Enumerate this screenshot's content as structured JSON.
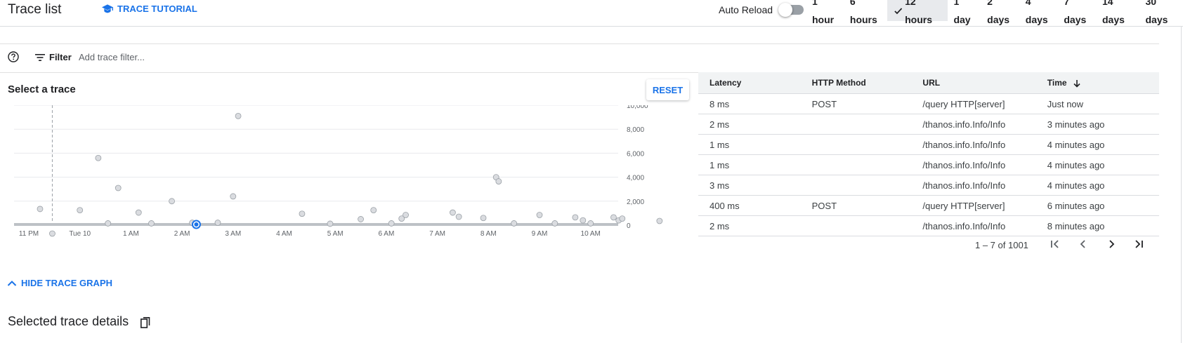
{
  "header": {
    "title": "Trace list",
    "tutorial_label": "TRACE TUTORIAL",
    "auto_reload_label": "Auto Reload",
    "auto_reload_on": false,
    "time_ranges": [
      {
        "label": "1 hour",
        "active": false
      },
      {
        "label": "6 hours",
        "active": false
      },
      {
        "label": "12 hours",
        "active": true
      },
      {
        "label": "1 day",
        "active": false
      },
      {
        "label": "2 days",
        "active": false
      },
      {
        "label": "4 days",
        "active": false
      },
      {
        "label": "7 days",
        "active": false
      },
      {
        "label": "14 days",
        "active": false
      },
      {
        "label": "30 days",
        "active": false
      }
    ]
  },
  "filter": {
    "label": "Filter",
    "placeholder": "Add trace filter..."
  },
  "chart": {
    "title": "Select a trace",
    "reset_label": "RESET"
  },
  "chart_data": {
    "type": "scatter",
    "x_ticks": [
      "11 PM",
      "Tue 10",
      "1 AM",
      "2 AM",
      "3 AM",
      "4 AM",
      "5 AM",
      "6 AM",
      "7 AM",
      "8 AM",
      "9 AM",
      "10 AM"
    ],
    "y_ticks": [
      "10,000",
      "8,000",
      "6,000",
      "4,000",
      "2,000",
      "0"
    ],
    "ylim": [
      0,
      10000
    ],
    "xlim": [
      0,
      12
    ],
    "ylabel": "",
    "xlabel": "",
    "grid": true,
    "y_axis_side": "right",
    "selected_x": 0.46,
    "points": [
      {
        "x": 0.22,
        "y": 1350
      },
      {
        "x": 0.46,
        "y": -700
      },
      {
        "x": 1.0,
        "y": 1250
      },
      {
        "x": 1.36,
        "y": 5600
      },
      {
        "x": 1.75,
        "y": 3100
      },
      {
        "x": 2.15,
        "y": 1050
      },
      {
        "x": 2.8,
        "y": 2000
      },
      {
        "x": 3.2,
        "y": 200
      },
      {
        "x": 3.3,
        "y": 0
      },
      {
        "x": 4.0,
        "y": 2400
      },
      {
        "x": 4.1,
        "y": 9100
      },
      {
        "x": 5.35,
        "y": 950
      },
      {
        "x": 6.5,
        "y": 500
      },
      {
        "x": 6.75,
        "y": 1250
      },
      {
        "x": 7.3,
        "y": 550
      },
      {
        "x": 7.38,
        "y": 850
      },
      {
        "x": 8.3,
        "y": 1050
      },
      {
        "x": 8.42,
        "y": 700
      },
      {
        "x": 8.9,
        "y": 600
      },
      {
        "x": 9.15,
        "y": 4000
      },
      {
        "x": 9.2,
        "y": 3650
      },
      {
        "x": 10.0,
        "y": 850
      },
      {
        "x": 10.7,
        "y": 650
      },
      {
        "x": 10.85,
        "y": 400
      },
      {
        "x": 11.45,
        "y": 650
      },
      {
        "x": 11.55,
        "y": 400
      },
      {
        "x": 11.62,
        "y": 550
      },
      {
        "x": 12.35,
        "y": 350
      },
      {
        "x": 1.55,
        "y": 150
      },
      {
        "x": 2.4,
        "y": 150
      },
      {
        "x": 3.7,
        "y": 200
      },
      {
        "x": 5.9,
        "y": 120
      },
      {
        "x": 7.1,
        "y": 150
      },
      {
        "x": 9.5,
        "y": 150
      },
      {
        "x": 10.3,
        "y": 150
      },
      {
        "x": 11.0,
        "y": 150
      }
    ]
  },
  "table": {
    "columns": [
      "Latency",
      "HTTP Method",
      "URL",
      "Time"
    ],
    "sort_column": "Time",
    "rows": [
      [
        "8 ms",
        "POST",
        "/query HTTP[server]",
        "Just now"
      ],
      [
        "2 ms",
        "",
        "/thanos.info.Info/Info",
        "3 minutes ago"
      ],
      [
        "1 ms",
        "",
        "/thanos.info.Info/Info",
        "4 minutes ago"
      ],
      [
        "1 ms",
        "",
        "/thanos.info.Info/Info",
        "4 minutes ago"
      ],
      [
        "3 ms",
        "",
        "/thanos.info.Info/Info",
        "4 minutes ago"
      ],
      [
        "400 ms",
        "POST",
        "/query HTTP[server]",
        "6 minutes ago"
      ],
      [
        "2 ms",
        "",
        "/thanos.info.Info/Info",
        "8 minutes ago"
      ]
    ],
    "pagination": "1 – 7 of 1001"
  },
  "footer": {
    "hide_graph_label": "HIDE TRACE GRAPH",
    "details_title": "Selected trace details"
  },
  "colors": {
    "accent": "#1a73e8",
    "point": "#dadce0",
    "point_stroke": "#9aa0a6",
    "grid": "#e8eaed"
  }
}
